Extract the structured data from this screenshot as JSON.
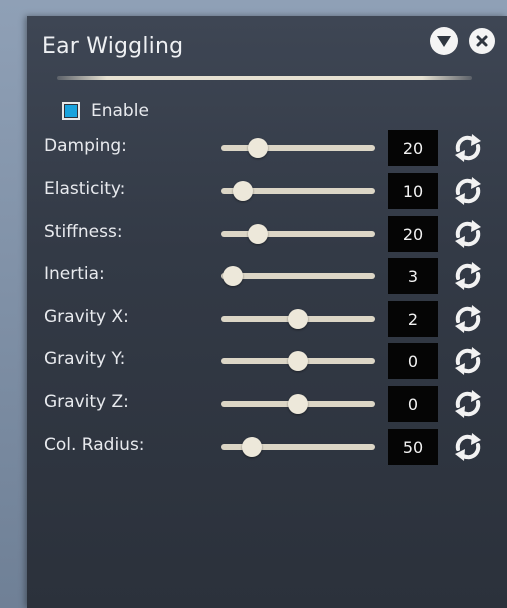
{
  "panel": {
    "title": "Ear Wiggling",
    "enable_label": "Enable",
    "enable_checked": true,
    "accent_color": "#1aa3dd"
  },
  "header": {
    "collapse_icon": "triangle-down-icon",
    "close_icon": "close-icon"
  },
  "params": [
    {
      "label": "Damping:",
      "value": "20",
      "slider_fraction": 0.24
    },
    {
      "label": "Elasticity:",
      "value": "10",
      "slider_fraction": 0.14
    },
    {
      "label": "Stiffness:",
      "value": "20",
      "slider_fraction": 0.24
    },
    {
      "label": "Inertia:",
      "value": "3",
      "slider_fraction": 0.08
    },
    {
      "label": "Gravity X:",
      "value": "2",
      "slider_fraction": 0.5
    },
    {
      "label": "Gravity Y:",
      "value": "0",
      "slider_fraction": 0.5
    },
    {
      "label": "Gravity Z:",
      "value": "0",
      "slider_fraction": 0.5
    },
    {
      "label": "Col. Radius:",
      "value": "50",
      "slider_fraction": 0.2
    }
  ]
}
